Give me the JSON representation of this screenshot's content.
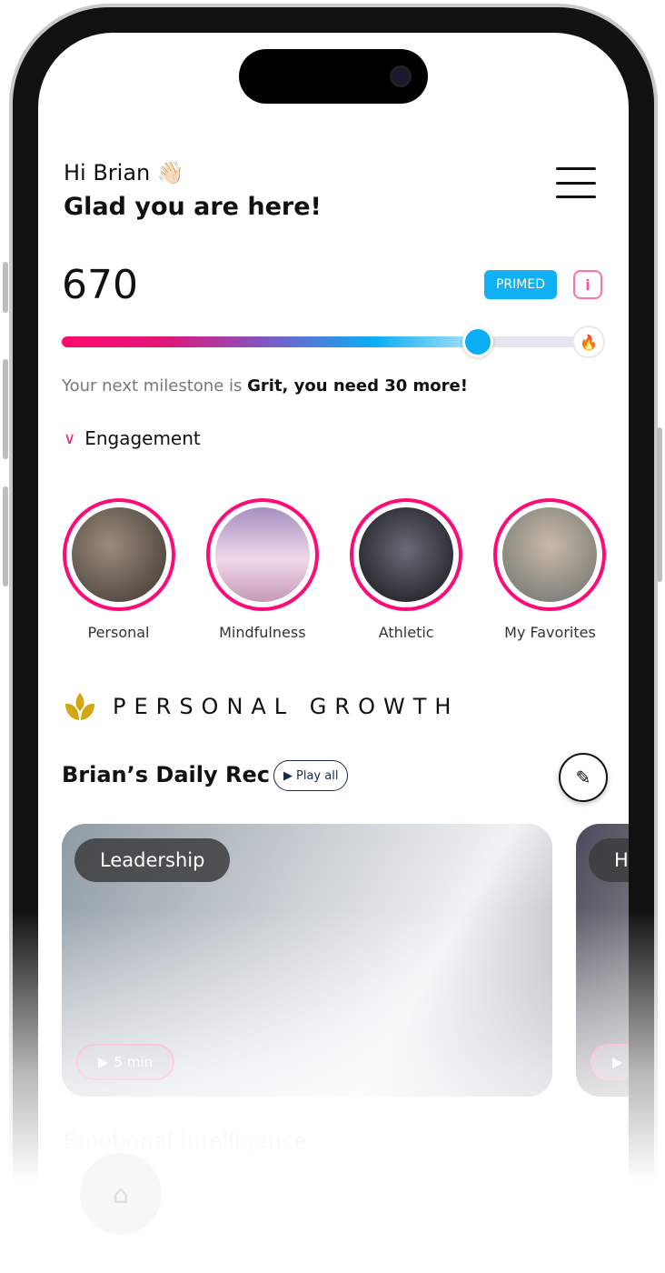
{
  "greeting": {
    "hi": "Hi Brian",
    "wave_icon": "👋🏻",
    "subtitle": "Glad you are here!"
  },
  "score": {
    "value": "670",
    "status_badge": "PRIMED",
    "info_icon": "i",
    "progress_fraction": 0.79,
    "milestone_prefix": "Your next milestone is",
    "milestone_bold": "Grit, you need 30 more!"
  },
  "engagement": {
    "label": "Engagement"
  },
  "categories": [
    {
      "label": "Personal",
      "color": "#5a5048"
    },
    {
      "label": "Mindfulness",
      "color": "#c9a7c9"
    },
    {
      "label": "Athletic",
      "color": "#2a2a35"
    },
    {
      "label": "My Favorites",
      "color": "#7d8580"
    }
  ],
  "section": {
    "title": "PERSONAL GROWTH"
  },
  "daily_rec": {
    "title": "Brian’s Daily Rec",
    "play_all": "Play all"
  },
  "cards": [
    {
      "tag": "Leadership",
      "duration": "5 min"
    },
    {
      "tag": "H",
      "duration": ""
    }
  ],
  "next_section": "Emotional Intelligence",
  "colors": {
    "accent": "#ff0a78",
    "primary_blue": "#0fb0f5"
  }
}
